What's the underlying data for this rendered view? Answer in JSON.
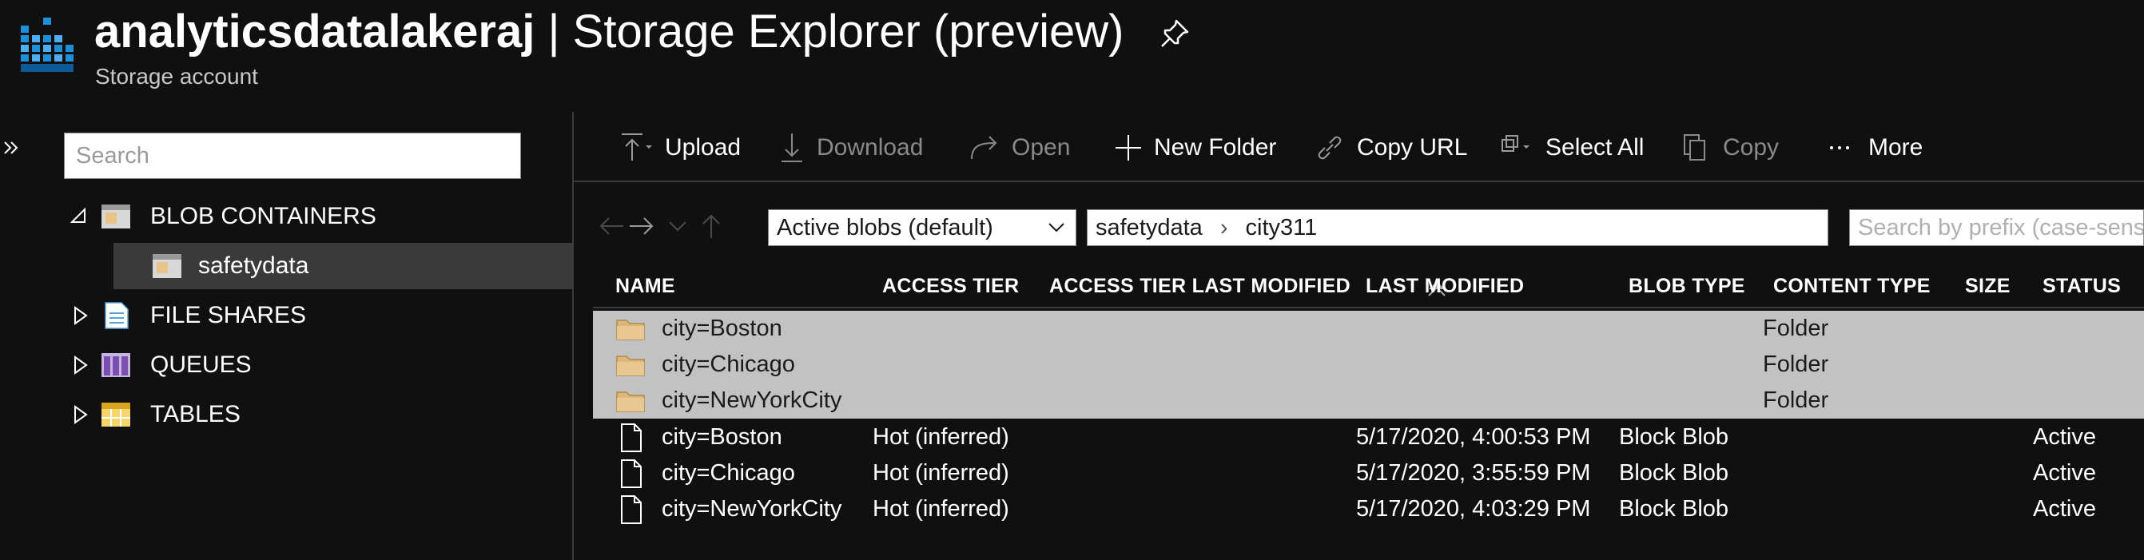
{
  "header": {
    "account_name": "analyticsdatalakeraj",
    "title_suffix": " | Storage Explorer (preview)",
    "subtitle": "Storage account"
  },
  "sidebar": {
    "search_placeholder": "Search",
    "items": [
      {
        "label": "BLOB CONTAINERS",
        "expanded": true
      },
      {
        "label": "safetydata",
        "selected": true
      },
      {
        "label": "FILE SHARES",
        "expanded": false
      },
      {
        "label": "QUEUES",
        "expanded": false
      },
      {
        "label": "TABLES",
        "expanded": false
      }
    ]
  },
  "toolbar": {
    "upload": "Upload",
    "download": "Download",
    "open": "Open",
    "new_folder": "New Folder",
    "copy_url": "Copy URL",
    "select_all": "Select All",
    "copy": "Copy",
    "more": "More"
  },
  "navbar": {
    "filter_value": "Active blobs (default)",
    "path_root": "safetydata",
    "path_leaf": "city311",
    "prefix_placeholder": "Search by prefix (case-sensitive)"
  },
  "table": {
    "columns": [
      "NAME",
      "ACCESS TIER",
      "ACCESS TIER LAST MODIFIED",
      "LAST MODIFIED",
      "BLOB TYPE",
      "CONTENT TYPE",
      "SIZE",
      "STATUS"
    ],
    "folders": [
      {
        "name": "city=Boston",
        "content_type": "Folder"
      },
      {
        "name": "city=Chicago",
        "content_type": "Folder"
      },
      {
        "name": "city=NewYorkCity",
        "content_type": "Folder"
      }
    ],
    "files": [
      {
        "name": "city=Boston",
        "access_tier": "Hot (inferred)",
        "last_modified": "5/17/2020, 4:00:53 PM",
        "blob_type": "Block Blob",
        "status": "Active"
      },
      {
        "name": "city=Chicago",
        "access_tier": "Hot (inferred)",
        "last_modified": "5/17/2020, 3:55:59 PM",
        "blob_type": "Block Blob",
        "status": "Active"
      },
      {
        "name": "city=NewYorkCity",
        "access_tier": "Hot (inferred)",
        "last_modified": "5/17/2020, 4:03:29 PM",
        "blob_type": "Block Blob",
        "status": "Active"
      }
    ]
  },
  "colors": {
    "background": "#101010",
    "folder_row": "#c2c2c2",
    "selected_tree": "#3a3a3a",
    "folder_icon": "#dcb67a",
    "storage_logo": "#1e90d8"
  }
}
